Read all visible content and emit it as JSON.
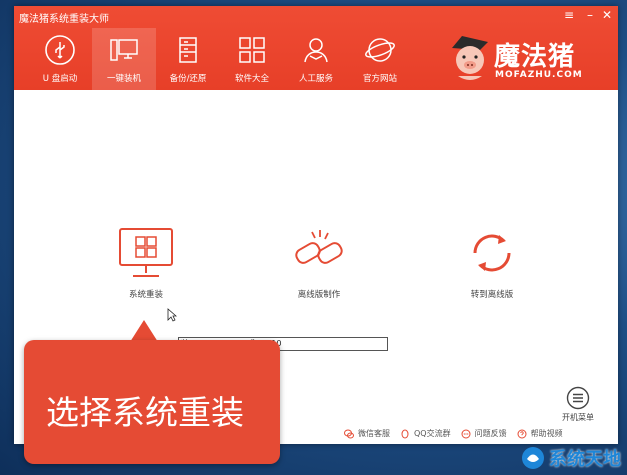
{
  "window": {
    "title": "魔法猪系统重装大师"
  },
  "nav": [
    {
      "label": "U 盘启动",
      "icon": "usb-icon"
    },
    {
      "label": "一键装机",
      "icon": "monitor-icon"
    },
    {
      "label": "备份/还原",
      "icon": "backup-icon"
    },
    {
      "label": "软件大全",
      "icon": "apps-grid-icon"
    },
    {
      "label": "人工服务",
      "icon": "support-person-icon"
    },
    {
      "label": "官方网站",
      "icon": "globe-icon"
    }
  ],
  "brand": {
    "name": "魔法猪",
    "url": "MOFAZHU.COM"
  },
  "options": [
    {
      "label": "系统重装",
      "icon": "windows-monitor-icon"
    },
    {
      "label": "离线版制作",
      "icon": "chain-link-icon"
    },
    {
      "label": "转到离线版",
      "icon": "refresh-icon"
    }
  ],
  "tooltip": "装XP,WIN7,WIN8或WIN10",
  "footer": [
    {
      "label": "微信客服",
      "icon": "wechat-icon"
    },
    {
      "label": "QQ交流群",
      "icon": "qq-icon"
    },
    {
      "label": "问题反馈",
      "icon": "feedback-icon"
    },
    {
      "label": "帮助视频",
      "icon": "help-icon"
    }
  ],
  "bootmenu": {
    "label": "开机菜单"
  },
  "callout": {
    "text": "选择系统重装"
  },
  "watermark": {
    "text": "系统天地"
  },
  "colors": {
    "accent": "#e73f28",
    "callout": "#e54b34",
    "watermark": "#1e86d8"
  }
}
